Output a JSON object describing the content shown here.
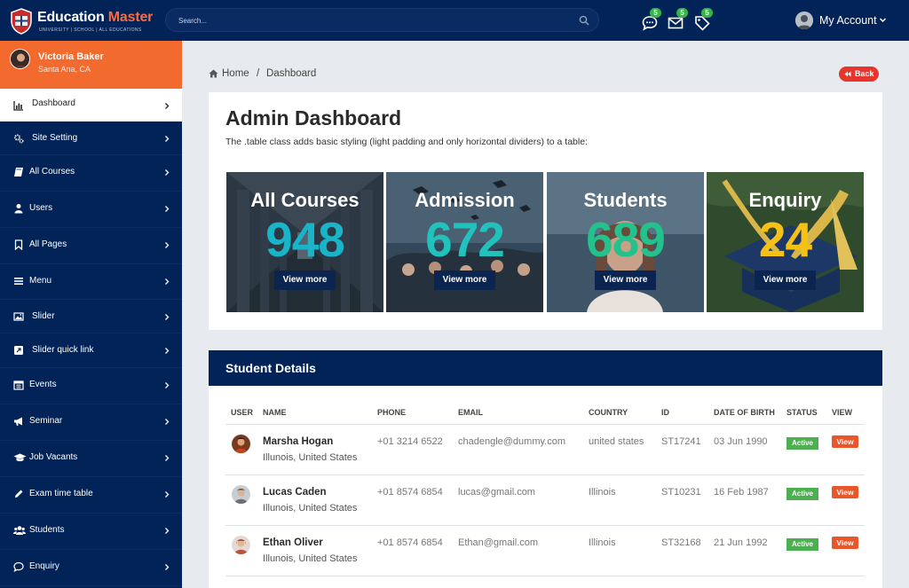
{
  "brand": {
    "name_part1": "Education",
    "name_part2": "Master",
    "tagline": "UNIVERSITY | SCHOOL | ALL EDUCATIONS"
  },
  "search": {
    "placeholder": "Search..."
  },
  "notifications": [
    {
      "icon": "chat-icon",
      "count": "5"
    },
    {
      "icon": "mail-icon",
      "count": "5"
    },
    {
      "icon": "tag-icon",
      "count": "5"
    }
  ],
  "account": {
    "label": "My Account"
  },
  "user": {
    "name": "Victoria Baker",
    "location": "Santa Ana, CA"
  },
  "sidebar": {
    "items": [
      {
        "label": "Dashboard",
        "icon": "bar-chart-icon",
        "active": true
      },
      {
        "label": "Site Setting",
        "icon": "gears-icon"
      },
      {
        "label": "All Courses",
        "icon": "book-icon"
      },
      {
        "label": "Users",
        "icon": "user-icon"
      },
      {
        "label": "All Pages",
        "icon": "bookmark-icon"
      },
      {
        "label": "Menu",
        "icon": "bars-icon"
      },
      {
        "label": "Slider",
        "icon": "image-icon"
      },
      {
        "label": "Slider quick link",
        "icon": "external-link-icon"
      },
      {
        "label": "Events",
        "icon": "calendar-icon"
      },
      {
        "label": "Seminar",
        "icon": "bullhorn-icon"
      },
      {
        "label": "Job Vacants",
        "icon": "graduation-cap-icon"
      },
      {
        "label": "Exam time table",
        "icon": "pencil-icon"
      },
      {
        "label": "Students",
        "icon": "users-icon"
      },
      {
        "label": "Enquiry",
        "icon": "comment-icon"
      }
    ]
  },
  "breadcrumb": {
    "home": "Home",
    "separator": "/",
    "current": "Dashboard"
  },
  "back_button": {
    "label": "Back"
  },
  "dashboard": {
    "title": "Admin Dashboard",
    "subtitle": "The .table class adds basic styling (light padding and only horizontal dividers) to a table:",
    "cards": [
      {
        "title": "All Courses",
        "value": "948",
        "button": "View more",
        "color": "#1ab4c8"
      },
      {
        "title": "Admission",
        "value": "672",
        "button": "View more",
        "color": "#22c2bc"
      },
      {
        "title": "Students",
        "value": "689",
        "button": "View more",
        "color": "#23c28c"
      },
      {
        "title": "Enquiry",
        "value": "24",
        "button": "View more",
        "color": "#f6c117"
      }
    ]
  },
  "students": {
    "title": "Student Details",
    "columns": [
      "USER",
      "NAME",
      "PHONE",
      "EMAIL",
      "COUNTRY",
      "ID",
      "DATE OF BIRTH",
      "STATUS",
      "VIEW"
    ],
    "rows": [
      {
        "name": "Marsha Hogan",
        "location": "Illunois, United States",
        "phone": "+01 3214 6522",
        "email": "chadengle@dummy.com",
        "country": "united states",
        "id": "ST17241",
        "dob": "03 Jun 1990",
        "status": "Active",
        "view": "View"
      },
      {
        "name": "Lucas Caden",
        "location": "Illunois, United States",
        "phone": "+01 8574 6854",
        "email": "lucas@gmail.com",
        "country": "Illinois",
        "id": "ST10231",
        "dob": "16 Feb 1987",
        "status": "Active",
        "view": "View"
      },
      {
        "name": "Ethan Oliver",
        "location": "Illunois, United States",
        "phone": "+01 8574 6854",
        "email": "Ethan@gmail.com",
        "country": "Illinois",
        "id": "ST32168",
        "dob": "21 Jun 1992",
        "status": "Active",
        "view": "View"
      }
    ]
  },
  "colors": {
    "navy": "#022357",
    "orange": "#f26a2e",
    "active_green": "#4caf50",
    "view_orange": "#e8562a",
    "back_red": "#e8352b"
  }
}
